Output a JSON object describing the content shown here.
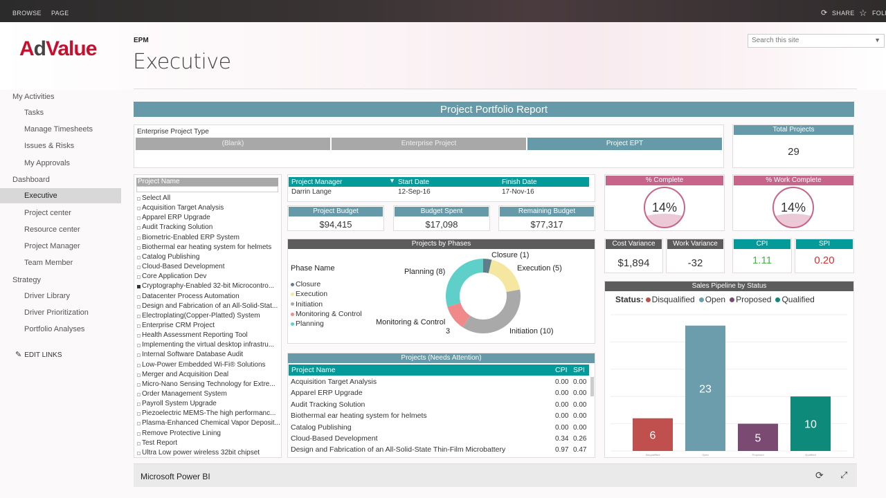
{
  "topbar": {
    "browse": "BROWSE",
    "page": "PAGE",
    "share": "SHARE",
    "follow": "FOLL"
  },
  "logo": {
    "a": "A",
    "d": "d",
    "value": "Value"
  },
  "header": {
    "site": "EPM",
    "title": "Executive",
    "search_placeholder": "Search this site"
  },
  "nav": {
    "groups": [
      {
        "label": "My Activities",
        "items": [
          "Tasks",
          "Manage Timesheets",
          "Issues & Risks",
          "My Approvals"
        ]
      },
      {
        "label": "Dashboard",
        "items": [
          "Executive",
          "Project center",
          "Resource center",
          "Project Manager",
          "Team Member"
        ]
      },
      {
        "label": "Strategy",
        "items": [
          "Driver Library",
          "Driver Prioritization",
          "Portfolio Analyses"
        ]
      }
    ],
    "selected": "Executive",
    "edit_links": "EDIT LINKS"
  },
  "report": {
    "title": "Project Portfolio Report",
    "ept_label": "Enterprise Project Type",
    "ept_buttons": [
      "(Blank)",
      "Enterprise Project",
      "Project EPT"
    ],
    "total_projects_label": "Total Projects",
    "total_projects": "29",
    "project_name_header": "Project Name",
    "project_list": [
      "Select All",
      "Acquisition Target Analysis",
      "Apparel ERP Upgrade",
      "Audit Tracking Solution",
      "Biometric-Enabled ERP System",
      "Biothermal ear heating system for helmets",
      "Catalog Publishing",
      "Cloud-Based Development",
      "Core Application Dev",
      "Cryptography-Enabled 32-bit Microcontro...",
      "Datacenter Process Automation",
      "Design and Fabrication of an All-Solid-Stat...",
      "Electroplating(Copper-Platted) System",
      "Enterprise CRM Project",
      "Health Assessment Reporting Tool",
      "Implementing the virtual desktop infrastru...",
      "Internal Software Database Audit",
      "Low-Power Embedded Wi-Fi® Solutions",
      "Merger and Acquisition Deal",
      "Micro-Nano Sensing Technology for Extre...",
      "Order Management System",
      "Payroll System Upgrade",
      "Piezoelectric MEMS-The high performanc...",
      "Plasma-Enhanced Chemical Vapor Deposit...",
      "Remove Protective Lining",
      "Test Report",
      "Ultra Low power wireless 32bit chipset"
    ],
    "pm_table": {
      "headers": [
        "Project Manager",
        "Start Date",
        "Finish Date"
      ],
      "row": [
        "Darrin Lange",
        "12-Sep-16",
        "17-Nov-16"
      ]
    },
    "budget": {
      "labels": [
        "Project Budget",
        "Budget Spent",
        "Remaining Budget"
      ],
      "values": [
        "$94,415",
        "$17,098",
        "$77,317"
      ]
    },
    "pct_complete": {
      "label": "% Complete",
      "value": "14%"
    },
    "work_complete": {
      "label": "% Work Complete",
      "value": "14%"
    },
    "cost_variance": {
      "label": "Cost Variance",
      "value": "$1,894"
    },
    "work_variance": {
      "label": "Work Variance",
      "value": "-32"
    },
    "cpi": {
      "label": "CPI",
      "value": "1.11"
    },
    "spi": {
      "label": "SPI",
      "value": "0.20"
    },
    "phases": {
      "title": "Projects by Phases",
      "legend_title": "Phase Name",
      "items": [
        {
          "name": "Closure",
          "value": 1,
          "label": "Closure (1)",
          "color": "#607d8b"
        },
        {
          "name": "Execution",
          "value": 5,
          "label": "Execution (5)",
          "color": "#f5e6a0"
        },
        {
          "name": "Initiation",
          "value": 10,
          "label": "Initiation (10)",
          "color": "#a9a9a9"
        },
        {
          "name": "Monitoring & Control",
          "value": 3,
          "label": "Monitoring & Control",
          "label2": "3",
          "color": "#f08a8a"
        },
        {
          "name": "Planning",
          "value": 8,
          "label": "Planning (8)",
          "color": "#5fcfc9"
        }
      ]
    },
    "attention": {
      "title": "Projects (Needs Attention)",
      "headers": [
        "Project Name",
        "CPI",
        "SPI"
      ],
      "rows": [
        [
          "Acquisition Target Analysis",
          "0.00",
          "0.00"
        ],
        [
          "Apparel ERP Upgrade",
          "0.00",
          "0.00"
        ],
        [
          "Audit Tracking Solution",
          "0.00",
          "0.00"
        ],
        [
          "Biothermal ear heating system for helmets",
          "0.00",
          "0.00"
        ],
        [
          "Catalog Publishing",
          "0.00",
          "0.00"
        ],
        [
          "Cloud-Based Development",
          "0.34",
          "0.26"
        ],
        [
          "Design and Fabrication of an All-Solid-State Thin-Film Microbattery",
          "0.97",
          "0.47"
        ]
      ]
    },
    "pipeline": {
      "title": "Sales Pipeline by Status",
      "legend_title": "Status:",
      "categories": [
        "Disqualified",
        "Open",
        "Proposed",
        "Qualified"
      ],
      "colors": [
        "#c0504d",
        "#6b9dad",
        "#7b4a72",
        "#0d8a7a"
      ]
    }
  },
  "chart_data": {
    "type": "bar",
    "title": "Sales Pipeline by Status",
    "categories": [
      "Disqualified",
      "Open",
      "Proposed",
      "Qualified"
    ],
    "values": [
      6,
      23,
      5,
      10
    ],
    "ylim": [
      0,
      25
    ]
  },
  "footer": {
    "label": "Microsoft Power BI"
  }
}
